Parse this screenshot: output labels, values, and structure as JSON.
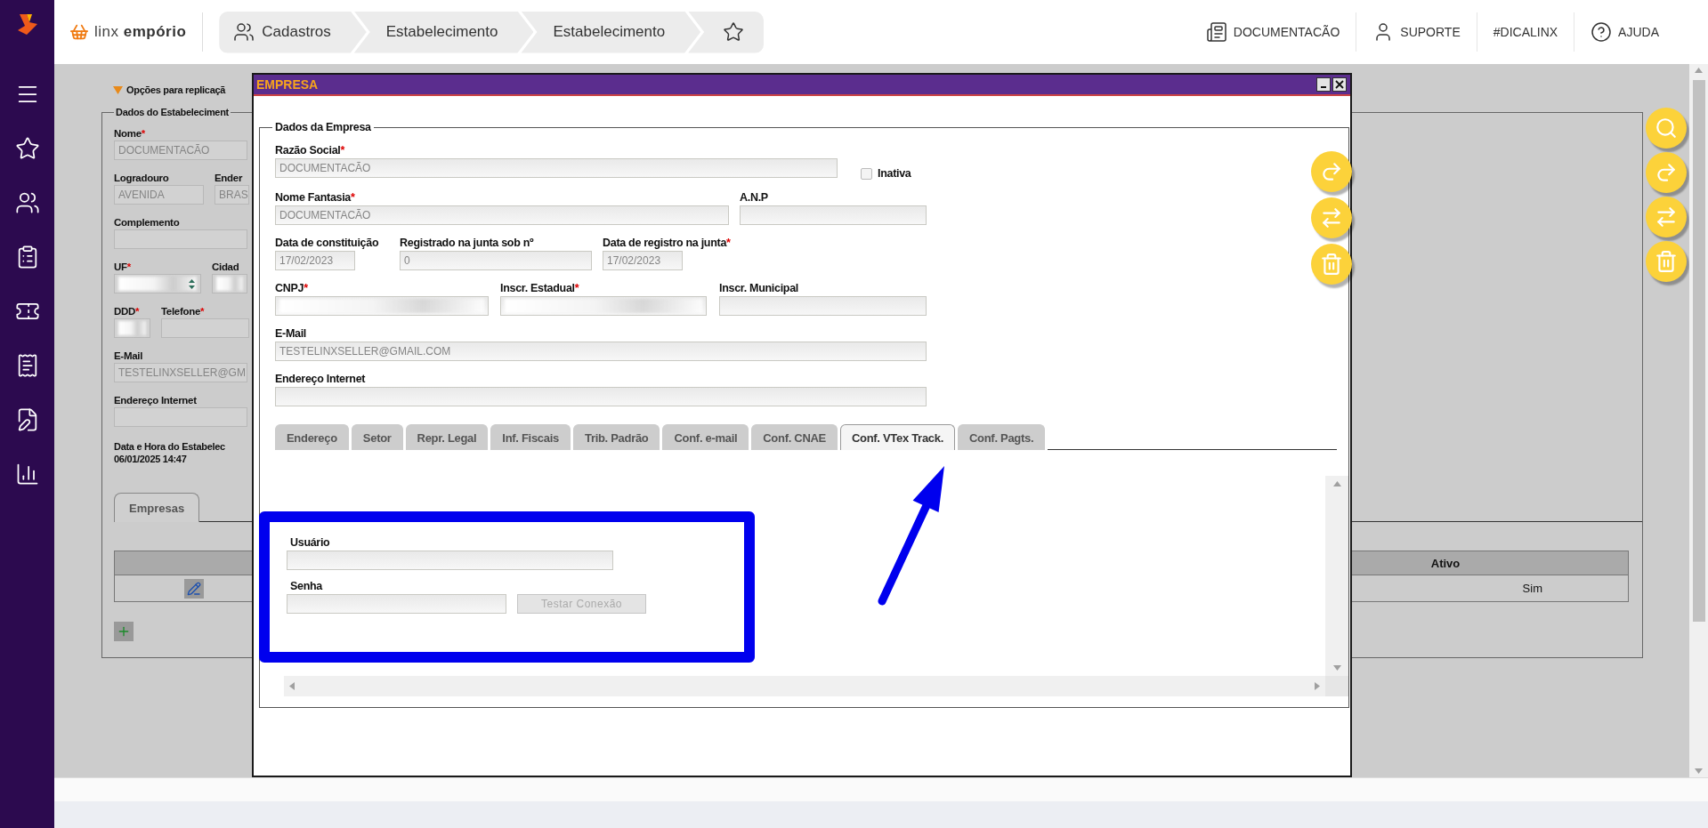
{
  "header": {
    "brand": "linx **empório**",
    "breadcrumbs": [
      {
        "label": "Cadastros",
        "kind": "section"
      },
      {
        "label": "Estabelecimento",
        "kind": "page"
      },
      {
        "label": "Estabelecimento",
        "kind": "page"
      }
    ],
    "links": [
      {
        "label": "DOCUMENTACÃO",
        "kind": "docs"
      },
      {
        "label": "SUPORTE",
        "kind": "support"
      },
      {
        "label": "#DICALINX",
        "kind": "plain"
      },
      {
        "label": "AJUDA",
        "kind": "help"
      }
    ]
  },
  "background": {
    "replication": {
      "label": "Opções para replicaçã",
      "expanded": true
    },
    "legend": "Dados do Estabeleciment",
    "rows": [
      [
        {
          "label": "Nome",
          "mark": "*",
          "kind": "text",
          "value": "DOCUMENTACÃO"
        }
      ],
      [
        {
          "label": "Logradouro",
          "kind": "text",
          "value": "AVENIDA"
        },
        {
          "label": "Ender",
          "kind": "text",
          "value": "BRAS"
        }
      ],
      [
        {
          "label": "Complemento",
          "kind": "text"
        }
      ],
      [
        {
          "label": "UF",
          "mark": "*",
          "kind": "select"
        },
        {
          "label": "Cidad",
          "kind": "blurred"
        }
      ],
      [
        {
          "label": "DDD",
          "mark": "*",
          "kind": "blurred"
        },
        {
          "label": "Telefone",
          "mark": "*",
          "kind": "text"
        }
      ],
      [
        {
          "label": "E-Mail",
          "kind": "text",
          "value": "TESTELINXSELLER@GM"
        }
      ],
      [
        {
          "label": "Endereço Internet",
          "kind": "text"
        }
      ]
    ],
    "datetime": {
      "label": "Data e Hora do Estabelec",
      "value": "06/01/2025 14:47"
    },
    "tabs": [
      {
        "label": "Empresas",
        "selected": true
      }
    ],
    "table": {
      "header": "Ativo",
      "rows": [
        {
          "active": "Sim"
        }
      ]
    }
  },
  "modal": {
    "title": "EMPRESA",
    "legend": "Dados da Empresa",
    "rows": [
      [
        {
          "label": "Razão Social",
          "mark": "*",
          "kind": "text",
          "value": "DOCUMENTACÃO"
        }
      ],
      [
        {
          "label": "Nome Fantasia",
          "mark": "*",
          "kind": "text",
          "value": "DOCUMENTACÃO"
        },
        {
          "label": "A.N.P",
          "kind": "text"
        }
      ],
      [
        {
          "label": "Data de constituição",
          "kind": "text",
          "value": "17/02/2023"
        },
        {
          "label": "Registrado na junta sob nº",
          "kind": "text",
          "value": "0"
        },
        {
          "label": "Data de registro na junta",
          "mark": "*",
          "kind": "text",
          "value": "17/02/2023"
        }
      ],
      [
        {
          "label": "CNPJ",
          "mark": "*",
          "kind": "blurred"
        },
        {
          "label": "Inscr. Estadual",
          "mark": "*",
          "kind": "blurred"
        },
        {
          "label": "Inscr. Municipal",
          "kind": "text"
        }
      ],
      [
        {
          "label": "E-Mail",
          "kind": "text",
          "value": "TESTELINXSELLER@GMAIL.COM"
        }
      ],
      [
        {
          "label": "Endereço Internet",
          "kind": "text"
        }
      ]
    ],
    "inactive": {
      "label": "Inativa",
      "checked": false
    },
    "tabs": [
      {
        "label": "Endereço",
        "selected": false
      },
      {
        "label": "Setor",
        "selected": false
      },
      {
        "label": "Repr. Legal",
        "selected": false
      },
      {
        "label": "Inf. Fiscais",
        "selected": false
      },
      {
        "label": "Trib. Padrão",
        "selected": false
      },
      {
        "label": "Conf. e-mail",
        "selected": false
      },
      {
        "label": "Conf. CNAE",
        "selected": false
      },
      {
        "label": "Conf. VTex Track.",
        "selected": true
      },
      {
        "label": "Conf. Pagts.",
        "selected": false
      }
    ],
    "tab_content": {
      "fields": [
        {
          "label": "Usuário"
        },
        {
          "label": "Senha"
        }
      ],
      "button": {
        "label": "Testar Conexão",
        "disabled": true
      }
    }
  }
}
